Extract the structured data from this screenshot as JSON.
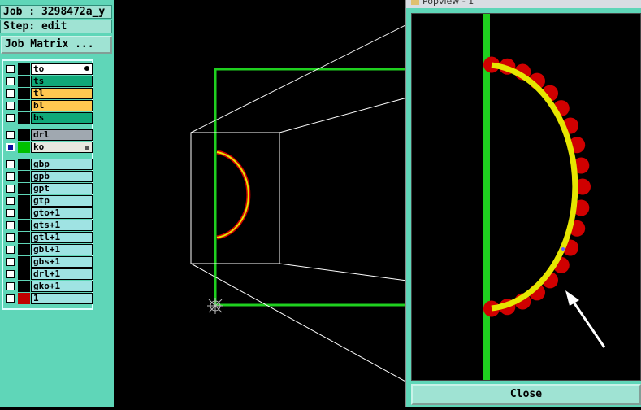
{
  "job": "Job : 3298472a_y",
  "step": "Step: edit",
  "job_matrix_label": "Job Matrix ...",
  "layers": [
    {
      "name": "to",
      "bg": "#ffffff",
      "swatch": "#000000",
      "checked": false,
      "suffix": "icon"
    },
    {
      "name": "ts",
      "bg": "#0fa878",
      "swatch": "#000000",
      "checked": false
    },
    {
      "name": "tl",
      "bg": "#ffc850",
      "swatch": "#000000",
      "checked": false
    },
    {
      "name": "bl",
      "bg": "#ffc850",
      "swatch": "#000000",
      "checked": false
    },
    {
      "name": "bs",
      "bg": "#0fa878",
      "swatch": "#000000",
      "checked": false
    },
    {
      "name": "drl",
      "bg": "#a0a8b0",
      "swatch": "#000000",
      "checked": false
    },
    {
      "name": "ko",
      "bg": "#e8e8e0",
      "swatch": "#00c000",
      "checked": true,
      "suffix": "square"
    },
    {
      "name": "gbp",
      "bg": "#9fe3e3",
      "swatch": "#000000",
      "checked": false
    },
    {
      "name": "gpb",
      "bg": "#9fe3e3",
      "swatch": "#000000",
      "checked": false
    },
    {
      "name": "gpt",
      "bg": "#9fe3e3",
      "swatch": "#000000",
      "checked": false
    },
    {
      "name": "gtp",
      "bg": "#9fe3e3",
      "swatch": "#000000",
      "checked": false
    },
    {
      "name": "gto+1",
      "bg": "#9fe3e3",
      "swatch": "#000000",
      "checked": false
    },
    {
      "name": "gts+1",
      "bg": "#9fe3e3",
      "swatch": "#000000",
      "checked": false
    },
    {
      "name": "gtl+1",
      "bg": "#9fe3e3",
      "swatch": "#000000",
      "checked": false
    },
    {
      "name": "gbl+1",
      "bg": "#9fe3e3",
      "swatch": "#000000",
      "checked": false
    },
    {
      "name": "gbs+1",
      "bg": "#9fe3e3",
      "swatch": "#000000",
      "checked": false
    },
    {
      "name": "drl+1",
      "bg": "#9fe3e3",
      "swatch": "#000000",
      "checked": false
    },
    {
      "name": "gko+1",
      "bg": "#9fe3e3",
      "swatch": "#000000",
      "checked": false
    },
    {
      "name": "1",
      "bg": "#9fe3e3",
      "swatch": "#c00000",
      "checked": false
    }
  ],
  "popup_title": "Popview - 1",
  "close_label": "Close",
  "colors": {
    "board_outline": "#1fd01f",
    "arc_yellow": "#e6e600",
    "arc_red": "#d00000",
    "zoom_frame": "#ffffff",
    "panel_bg": "#5fd6b8"
  }
}
